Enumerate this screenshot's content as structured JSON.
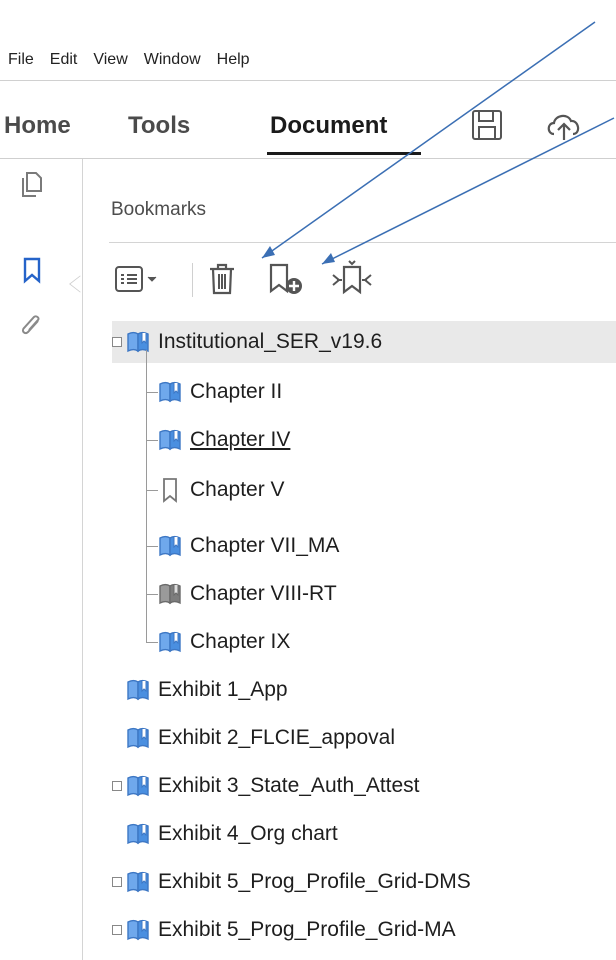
{
  "menu": [
    "File",
    "Edit",
    "View",
    "Window",
    "Help"
  ],
  "tabs": [
    {
      "label": "Home",
      "active": false
    },
    {
      "label": "Tools",
      "active": false
    },
    {
      "label": "Document",
      "active": true
    }
  ],
  "panel": {
    "title": "Bookmarks"
  },
  "bookmarks": [
    {
      "label": "Institutional_SER_v19.6",
      "level": 0,
      "expander": true,
      "selected": true,
      "icon": "bookmark-book-icon"
    },
    {
      "label": "Chapter II",
      "level": 1,
      "icon": "bookmark-book-icon"
    },
    {
      "label": "Chapter IV",
      "level": 1,
      "underline": true,
      "icon": "bookmark-book-icon"
    },
    {
      "label": "Chapter V",
      "level": 1,
      "icon": "bookmark-outline-icon"
    },
    {
      "label": "Chapter VII_MA",
      "level": 1,
      "icon": "bookmark-book-icon"
    },
    {
      "label": "Chapter VIII-RT",
      "level": 1,
      "icon": "bookmark-gray-icon"
    },
    {
      "label": "Chapter IX",
      "level": 1,
      "icon": "bookmark-book-icon"
    },
    {
      "label": "Exhibit 1_App",
      "level": 0,
      "icon": "bookmark-book-icon"
    },
    {
      "label": "Exhibit 2_FLCIE_appoval",
      "level": 0,
      "icon": "bookmark-book-icon"
    },
    {
      "label": "Exhibit 3_State_Auth_Attest",
      "level": 0,
      "expander": true,
      "icon": "bookmark-book-icon"
    },
    {
      "label": "Exhibit 4_Org chart",
      "level": 0,
      "icon": "bookmark-book-icon"
    },
    {
      "label": "Exhibit 5_Prog_Profile_Grid-DMS",
      "level": 0,
      "expander": true,
      "icon": "bookmark-book-icon"
    },
    {
      "label": "Exhibit 5_Prog_Profile_Grid-MA",
      "level": 0,
      "expander": true,
      "icon": "bookmark-book-icon"
    }
  ],
  "colors": {
    "accent": "#2563c9",
    "book_blue": "#4a8fe0",
    "arrow": "#3b6fb4"
  }
}
